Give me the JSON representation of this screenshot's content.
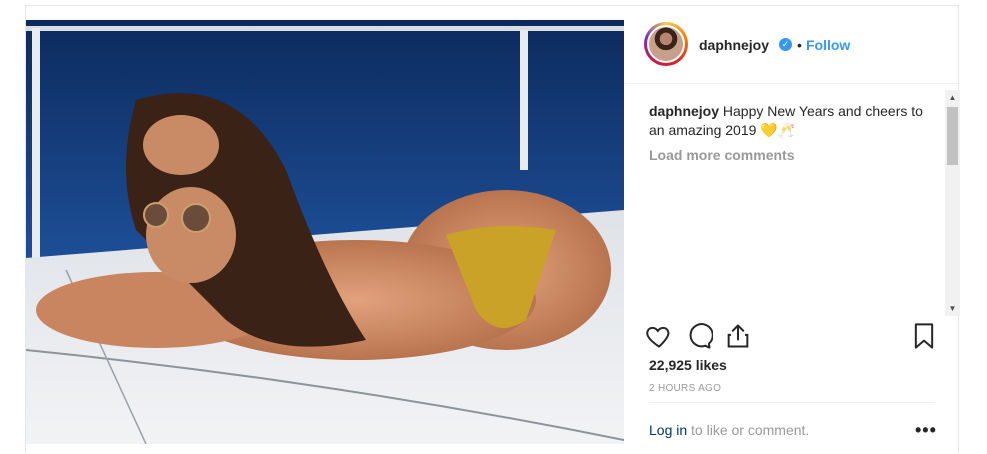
{
  "post": {
    "username": "daphnejoy",
    "verified_icon": "verified-badge-icon",
    "separator": "•",
    "follow_label": "Follow",
    "caption_user": "daphnejoy",
    "caption_text": "Happy New Years and cheers to an amazing 2019 💛🥂",
    "load_more": "Load more comments",
    "likes": "22,925 likes",
    "time": "2 HOURS AGO",
    "login_link": "Log in",
    "login_rest": " to like or comment.",
    "more_label": "•••",
    "icons": {
      "like": "heart-icon",
      "comment": "comment-icon",
      "share": "share-icon",
      "save": "bookmark-icon"
    },
    "colors": {
      "accent": "#3897f0",
      "muted": "#999999",
      "link": "#003569"
    }
  }
}
